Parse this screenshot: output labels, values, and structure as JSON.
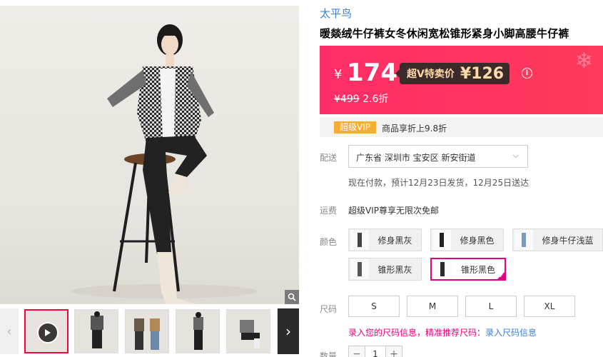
{
  "brand": "太平鸟",
  "product_title": "暖燚绒牛仔裤女冬休闲宽松锥形紧身小脚高腰牛仔裤",
  "price": {
    "currency": "¥",
    "current": "174",
    "vip_label": "超V特卖价",
    "vip_price": "¥126",
    "original": "¥499",
    "discount": "2.6折"
  },
  "vip_strip": {
    "badge": "超级VIP",
    "text": "商品享折上9.8折"
  },
  "delivery": {
    "label": "配送",
    "address": "广东省 深圳市 宝安区 新安街道",
    "note": "现在付款，预计12月23日发货，12月25日送达"
  },
  "freight": {
    "label": "运费",
    "text": "超级VIP尊享无限次免邮"
  },
  "colors": {
    "label": "颜色",
    "options": [
      "修身黑灰",
      "修身黑色",
      "修身牛仔浅蓝",
      "锥形黑灰",
      "锥形黑色"
    ],
    "selected": "锥形黑色"
  },
  "sizes": {
    "label": "尺码",
    "options": [
      "S",
      "M",
      "L",
      "XL"
    ],
    "note": "录入您的尺码信息，精准推荐尺码：",
    "note_link": "录入尺码信息"
  },
  "quantity": {
    "label": "数量",
    "value": "1",
    "minus": "−",
    "plus": "+"
  },
  "colors_accent": {
    "price_bg": "#ff2d67",
    "vip_pill_bg": "#3b2a2a",
    "select_border": "#e4007f",
    "brand_link": "#3c7fd6"
  }
}
